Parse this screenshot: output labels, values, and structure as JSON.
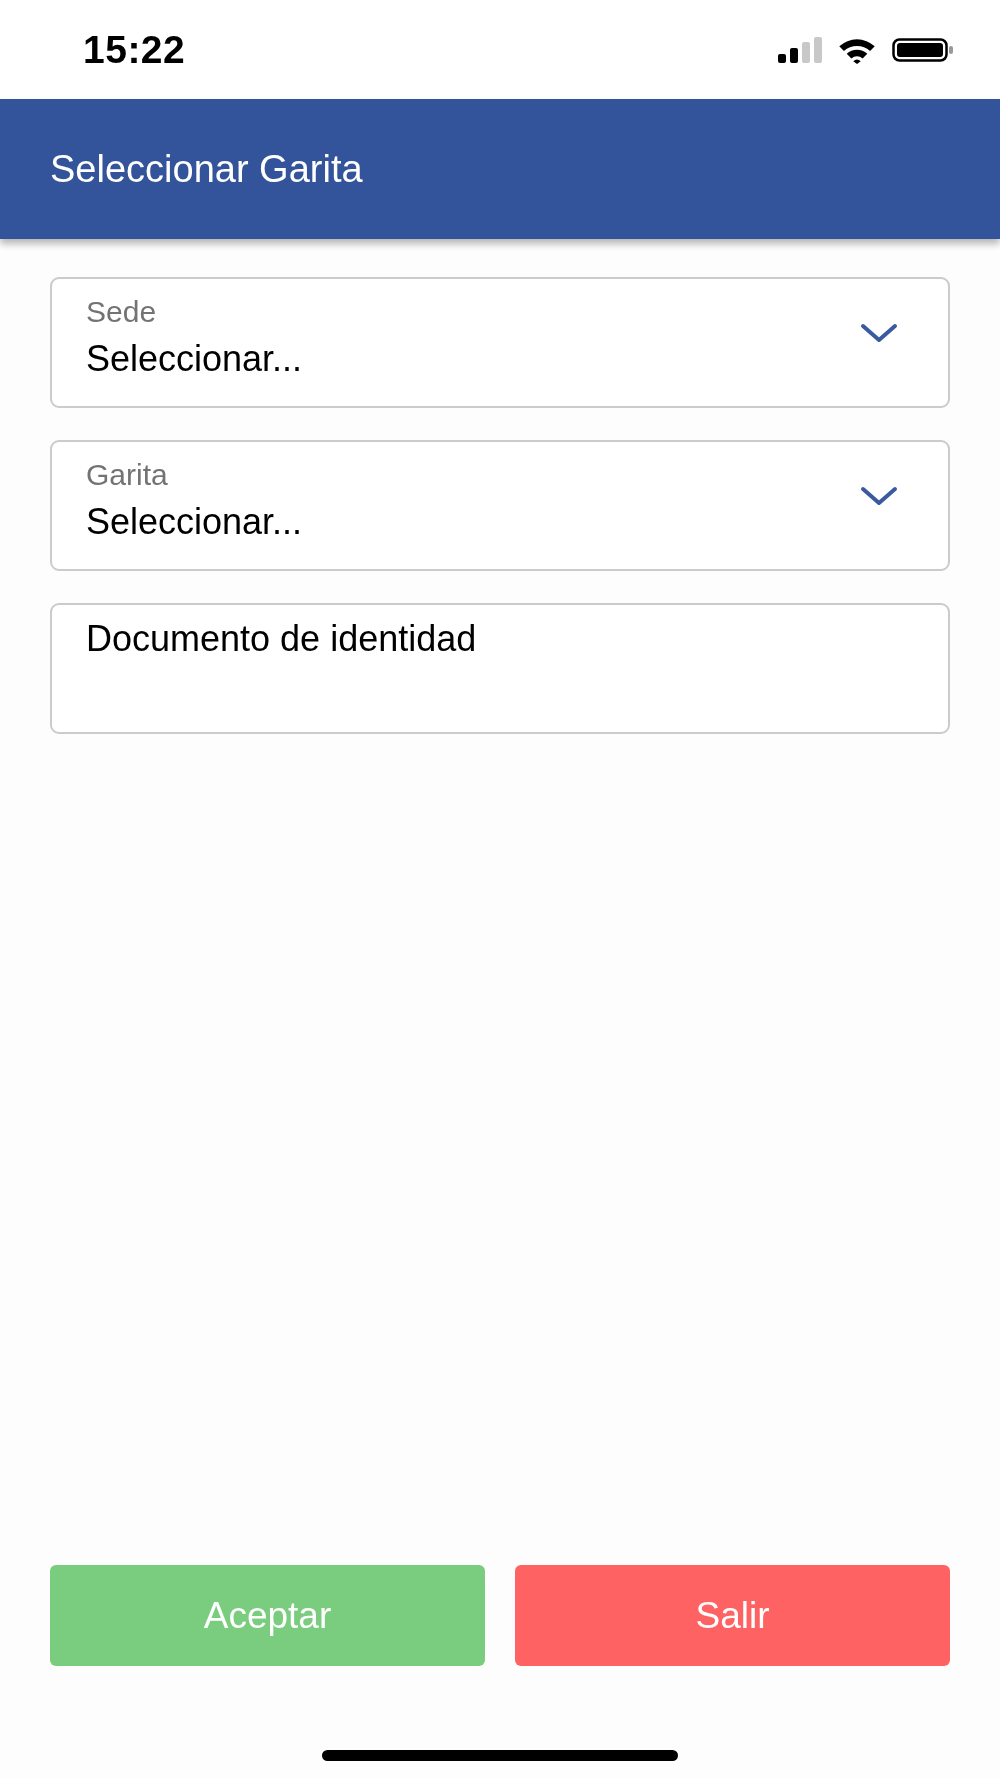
{
  "status_bar": {
    "time": "15:22"
  },
  "header": {
    "title": "Seleccionar Garita"
  },
  "fields": [
    {
      "kind": "select",
      "label": "Sede",
      "value": "Seleccionar..."
    },
    {
      "kind": "select",
      "label": "Garita",
      "value": "Seleccionar..."
    },
    {
      "kind": "text",
      "placeholder": "Documento de identidad"
    }
  ],
  "buttons": [
    {
      "kind": "accept",
      "label": "Aceptar"
    },
    {
      "kind": "exit",
      "label": "Salir"
    }
  ]
}
